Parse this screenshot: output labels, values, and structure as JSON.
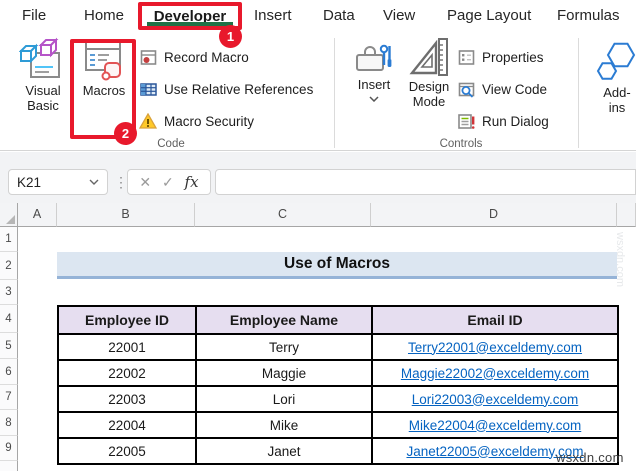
{
  "tabs": {
    "items": [
      "File",
      "Home",
      "Developer",
      "Insert",
      "Data",
      "View",
      "Page Layout",
      "Formulas"
    ],
    "active_tab": "Developer"
  },
  "callouts": {
    "one": "1",
    "two": "2"
  },
  "ribbon": {
    "groups": [
      {
        "label": "Code",
        "big_buttons": [
          {
            "label_line1": "Visual",
            "label_line2": "Basic",
            "icon": "visual-basic-icon"
          },
          {
            "label_line1": "Macros",
            "label_line2": "",
            "icon": "macros-icon"
          }
        ],
        "buttons": [
          {
            "label": "Record Macro",
            "icon": "record-macro-icon"
          },
          {
            "label": "Use Relative References",
            "icon": "relative-references-icon"
          },
          {
            "label": "Macro Security",
            "icon": "macro-security-icon"
          }
        ]
      },
      {
        "label": "Controls",
        "big_buttons": [
          {
            "label_line1": "Insert",
            "label_line2": "",
            "icon": "insert-controls-icon",
            "has_dropdown": true
          },
          {
            "label_line1": "Design",
            "label_line2": "Mode",
            "icon": "design-mode-icon"
          }
        ],
        "buttons": [
          {
            "label": "Properties",
            "icon": "properties-icon"
          },
          {
            "label": "View Code",
            "icon": "view-code-icon"
          },
          {
            "label": "Run Dialog",
            "icon": "run-dialog-icon"
          }
        ]
      },
      {
        "label": "",
        "big_buttons": [
          {
            "label_line1": "Add-",
            "label_line2": "ins",
            "icon": "add-ins-icon"
          }
        ],
        "buttons": []
      }
    ]
  },
  "formula_bar": {
    "name_box_value": "K21",
    "cancel_glyph": "✕",
    "enter_glyph": "✓",
    "fx_label": "fx",
    "separator_glyph": "⋮",
    "formula_value": ""
  },
  "sheet": {
    "column_headers": [
      "A",
      "B",
      "C",
      "D"
    ],
    "row_headers": [
      "1",
      "2",
      "3",
      "4",
      "5",
      "6",
      "7",
      "8",
      "9"
    ],
    "title_banner": "Use of Macros",
    "table": {
      "headers": [
        "Employee ID",
        "Employee Name",
        "Email ID"
      ],
      "rows": [
        {
          "id": "22001",
          "name": "Terry",
          "email": "Terry22001@exceldemy.com"
        },
        {
          "id": "22002",
          "name": "Maggie",
          "email": "Maggie22002@exceldemy.com"
        },
        {
          "id": "22003",
          "name": "Lori",
          "email": "Lori22003@exceldemy.com"
        },
        {
          "id": "22004",
          "name": "Mike",
          "email": "Mike22004@exceldemy.com"
        },
        {
          "id": "22005",
          "name": "Janet",
          "email": "Janet22005@exceldemy.com"
        }
      ]
    }
  },
  "watermark": {
    "text": "wsxdn.com"
  },
  "colors": {
    "annotation_red": "#E8192C",
    "active_tab_underline": "#1F7246",
    "title_fill": "#DCE6F1",
    "title_border": "#95B3D7",
    "table_header_fill": "#E6DEF0",
    "hyperlink_blue": "#0563C1",
    "warning_yellow": "#FFC928",
    "icon_blue": "#2B7CD3"
  }
}
